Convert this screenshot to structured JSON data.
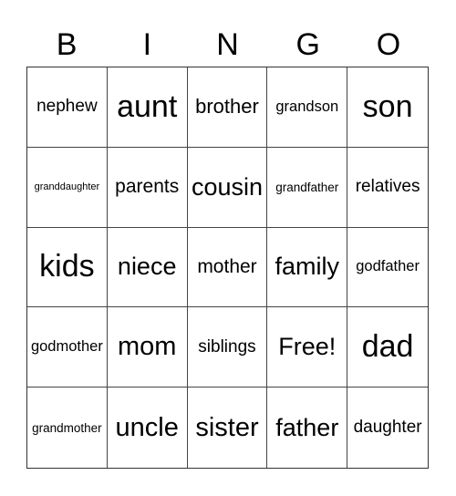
{
  "header": {
    "letters": [
      "B",
      "I",
      "N",
      "G",
      "O"
    ]
  },
  "card": {
    "rows": [
      [
        "nephew",
        "aunt",
        "brother",
        "grandson",
        "son"
      ],
      [
        "granddaughter",
        "parents",
        "cousin",
        "grandfather",
        "relatives"
      ],
      [
        "kids",
        "niece",
        "mother",
        "family",
        "godfather"
      ],
      [
        "godmother",
        "mom",
        "siblings",
        "Free!",
        "dad"
      ],
      [
        "grandmother",
        "uncle",
        "sister",
        "father",
        "daughter"
      ]
    ]
  }
}
